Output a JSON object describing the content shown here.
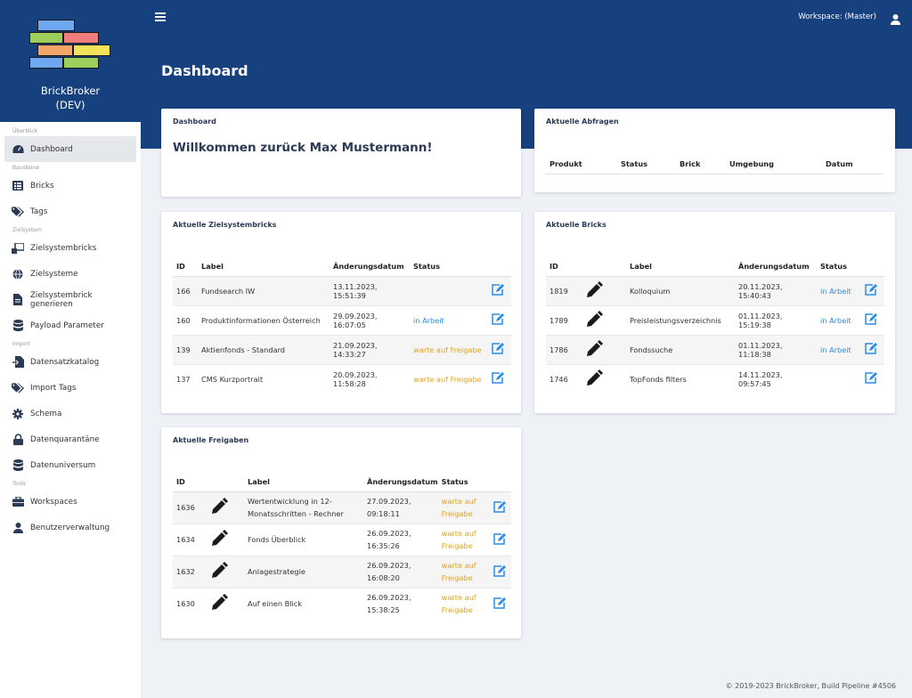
{
  "brand": {
    "name_line1": "BrickBroker",
    "name_line2": "(DEV)"
  },
  "colors": {
    "primary": "#17407f",
    "link": "#2a8ce6",
    "warning": "#e0a41a"
  },
  "sidebar": {
    "sections": {
      "overview": "Überblick",
      "building_blocks": "Bausteine",
      "target_system": "Zielsystem",
      "import": "Import",
      "tools": "Tools"
    },
    "items": [
      {
        "label": "Dashboard",
        "icon": "dashboard-icon"
      },
      {
        "label": "Bricks",
        "icon": "list-icon"
      },
      {
        "label": "Tags",
        "icon": "tags-icon"
      },
      {
        "label": "Zielsystembricks",
        "icon": "target-bricks-icon"
      },
      {
        "label": "Zielsysteme",
        "icon": "globe-icon"
      },
      {
        "label": "Zielsystembrick generieren",
        "icon": "file-icon"
      },
      {
        "label": "Payload Parameter",
        "icon": "database-icon"
      },
      {
        "label": "Datensatzkatalog",
        "icon": "file-import-icon"
      },
      {
        "label": "Import Tags",
        "icon": "tags-icon"
      },
      {
        "label": "Schema",
        "icon": "gear-icon"
      },
      {
        "label": "Datenquarantäne",
        "icon": "lock-icon"
      },
      {
        "label": "Datenuniversum",
        "icon": "database-icon"
      },
      {
        "label": "Workspaces",
        "icon": "briefcase-icon"
      },
      {
        "label": "Benutzerverwaltung",
        "icon": "user-icon"
      }
    ]
  },
  "header": {
    "workspace": "Workspace: (Master)",
    "page_title": "Dashboard"
  },
  "welcome_card": {
    "title": "Dashboard",
    "message": "Willkommen zurück Max Mustermann!"
  },
  "queries_card": {
    "title": "Aktuelle Abfragen",
    "columns": [
      "Produkt",
      "Status",
      "Brick",
      "Umgebung",
      "Datum"
    ]
  },
  "target_bricks_card": {
    "title": "Aktuelle Zielsystembricks",
    "columns": [
      "ID",
      "Label",
      "Änderungsdatum",
      "Status"
    ],
    "rows": [
      {
        "id": "166",
        "label": "Fundsearch IW",
        "date": "13.11.2023, 15:51:39",
        "status": "",
        "status_type": ""
      },
      {
        "id": "160",
        "label": "Produktinformationen Österreich",
        "date": "29.09.2023, 16:07:05",
        "status": "in Arbeit",
        "status_type": "arbeit"
      },
      {
        "id": "139",
        "label": "Aktienfonds - Standard",
        "date": "21.09.2023, 14:33:27",
        "status": "warte auf Freigabe",
        "status_type": "warte"
      },
      {
        "id": "137",
        "label": "CMS Kurzportrait",
        "date": "20.09.2023, 11:58:28",
        "status": "warte auf Freigabe",
        "status_type": "warte"
      }
    ]
  },
  "bricks_card": {
    "title": "Aktuelle Bricks",
    "columns": [
      "ID",
      "",
      "Label",
      "Änderungsdatum",
      "Status"
    ],
    "rows": [
      {
        "id": "1819",
        "label": "Kolloquium",
        "date": "20.11.2023, 15:40:43",
        "status": "in Arbeit",
        "status_type": "arbeit"
      },
      {
        "id": "1789",
        "label": "Preisleistungsverzeichnis",
        "date": "01.11.2023, 15:19:38",
        "status": "in Arbeit",
        "status_type": "arbeit"
      },
      {
        "id": "1786",
        "label": "Fondssuche",
        "date": "01.11.2023, 11:18:38",
        "status": "in Arbeit",
        "status_type": "arbeit"
      },
      {
        "id": "1746",
        "label": "TopFonds filters",
        "date": "14.11.2023, 09:57:45",
        "status": "",
        "status_type": ""
      }
    ]
  },
  "releases_card": {
    "title": "Aktuelle Freigaben",
    "columns": [
      "ID",
      "",
      "Label",
      "Änderungsdatum",
      "Status"
    ],
    "rows": [
      {
        "id": "1636",
        "label": "Wertentwicklung in 12-Monatsschritten - Rechner",
        "date": "27.09.2023, 09:18:11",
        "status": "warte auf Freigabe",
        "status_type": "warte"
      },
      {
        "id": "1634",
        "label": "Fonds Überblick",
        "date": "26.09.2023, 16:35:26",
        "status": "warte auf Freigabe",
        "status_type": "warte"
      },
      {
        "id": "1632",
        "label": "Anlagestrategie",
        "date": "26.09.2023, 16:08:20",
        "status": "warte auf Freigabe",
        "status_type": "warte"
      },
      {
        "id": "1630",
        "label": "Auf einen Blick",
        "date": "26.09.2023, 15:38:25",
        "status": "warte auf Freigabe",
        "status_type": "warte"
      }
    ]
  },
  "footer": {
    "text": "© 2019-2023 BrickBroker, Build Pipeline #4506"
  }
}
